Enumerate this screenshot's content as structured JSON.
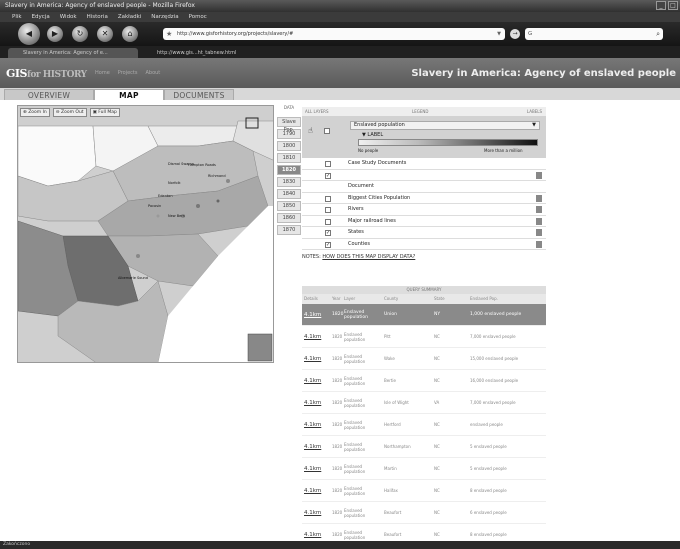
{
  "window": {
    "title": "Slavery in America: Agency of enslaved people - Mozilla Firefox",
    "btn_min": "_",
    "btn_max": "□"
  },
  "menu": [
    "Plik",
    "Edycja",
    "Widok",
    "Historia",
    "Zakładki",
    "Narzędzia",
    "Pomoc"
  ],
  "nav": {
    "back_glyph": "◀",
    "forward_glyph": "▶",
    "reload_glyph": "↻",
    "stop_glyph": "✕",
    "home_glyph": "⌂",
    "url": "http://www.gisforhistory.org/projects/slavery/#",
    "search_placeholder": "G",
    "go_glyph": "→",
    "search_glyph": "⌕"
  },
  "tabs": [
    {
      "label": "Slavery in America: Agency of e..."
    },
    {
      "label": "http://www.gis...ht_tabnew.html"
    }
  ],
  "site": {
    "logo_main": "GIS",
    "logo_sub": "for HISTORY",
    "nav_items": [
      "Home",
      "Projects",
      "About"
    ],
    "page_title": "Slavery in America: Agency of enslaved people"
  },
  "view_tabs": [
    "OVERVIEW",
    "MAP",
    "DOCUMENTS"
  ],
  "map": {
    "tools": [
      "Zoom In",
      "Zoom Out",
      "Full Map"
    ],
    "labels": [
      "Hampton Roads",
      "Richmond",
      "Norfolk",
      "Edenton",
      "Pocosin",
      "New Bern",
      "Albemarle Sound",
      "Dismal Swamp"
    ]
  },
  "years": {
    "header": "DATA",
    "items": [
      "Slave Pop.",
      "1790",
      "1800",
      "1810",
      "1820",
      "1830",
      "1840",
      "1850",
      "1860",
      "1870"
    ],
    "active": "1820"
  },
  "layers": {
    "header": [
      "ALL LAYERS",
      "LEGEND",
      "LABELS"
    ],
    "population_select": "Enslaved population",
    "legend_title": "▼ LABEL",
    "legend_low": "No people",
    "legend_high": "More than a million",
    "rows": [
      {
        "label": "Case Study Documents",
        "checked": ""
      },
      {
        "label": "",
        "checked": "✓"
      },
      {
        "label": "Document",
        "checked": ""
      },
      {
        "label": "Biggest Cities Population",
        "checked": ""
      },
      {
        "label": "Rivers",
        "checked": ""
      },
      {
        "label": "Major railroad lines",
        "checked": ""
      },
      {
        "label": "States",
        "checked": "✓"
      },
      {
        "label": "Counties",
        "checked": "✓"
      }
    ],
    "notes_prefix": "NOTES: ",
    "notes_link": "HOW DOES THIS MAP DISPLAY DATA?"
  },
  "query": {
    "title": "QUERY SUMMARY",
    "headers": [
      "Details",
      "Year",
      "Layer",
      "County",
      "State",
      "Enslaved Pop."
    ],
    "rows": [
      {
        "link": "4.1km",
        "year": "1820",
        "layer": "Enslaved population",
        "county": "Union",
        "state": "NY",
        "pop": "1,000 enslaved people"
      },
      {
        "link": "4.1km",
        "year": "1820",
        "layer": "Enslaved population",
        "county": "Pitt",
        "state": "NC",
        "pop": "7,000 enslaved people"
      },
      {
        "link": "4.1km",
        "year": "1820",
        "layer": "Enslaved population",
        "county": "Wake",
        "state": "NC",
        "pop": "15,000 enslaved people"
      },
      {
        "link": "4.1km",
        "year": "1820",
        "layer": "Enslaved population",
        "county": "Bertie",
        "state": "NC",
        "pop": "16,000 enslaved people"
      },
      {
        "link": "4.1km",
        "year": "1820",
        "layer": "Enslaved population",
        "county": "Isle of Wight",
        "state": "VA",
        "pop": "7,000 enslaved people"
      },
      {
        "link": "4.1km",
        "year": "1820",
        "layer": "Enslaved population",
        "county": "Hertford",
        "state": "NC",
        "pop": "enslaved people"
      },
      {
        "link": "4.1km",
        "year": "1820",
        "layer": "Enslaved population",
        "county": "Northampton",
        "state": "NC",
        "pop": "5 enslaved people"
      },
      {
        "link": "4.1km",
        "year": "1820",
        "layer": "Enslaved population",
        "county": "Martin",
        "state": "NC",
        "pop": "5 enslaved people"
      },
      {
        "link": "4.1km",
        "year": "1820",
        "layer": "Enslaved population",
        "county": "Halifax",
        "state": "NC",
        "pop": "8 enslaved people"
      },
      {
        "link": "4.1km",
        "year": "1820",
        "layer": "Enslaved population",
        "county": "Beaufort",
        "state": "NC",
        "pop": "6 enslaved people"
      },
      {
        "link": "4.1km",
        "year": "1820",
        "layer": "Enslaved population",
        "county": "Beaufort",
        "state": "NC",
        "pop": "8 enslaved people"
      }
    ]
  },
  "status": "Zakończono"
}
